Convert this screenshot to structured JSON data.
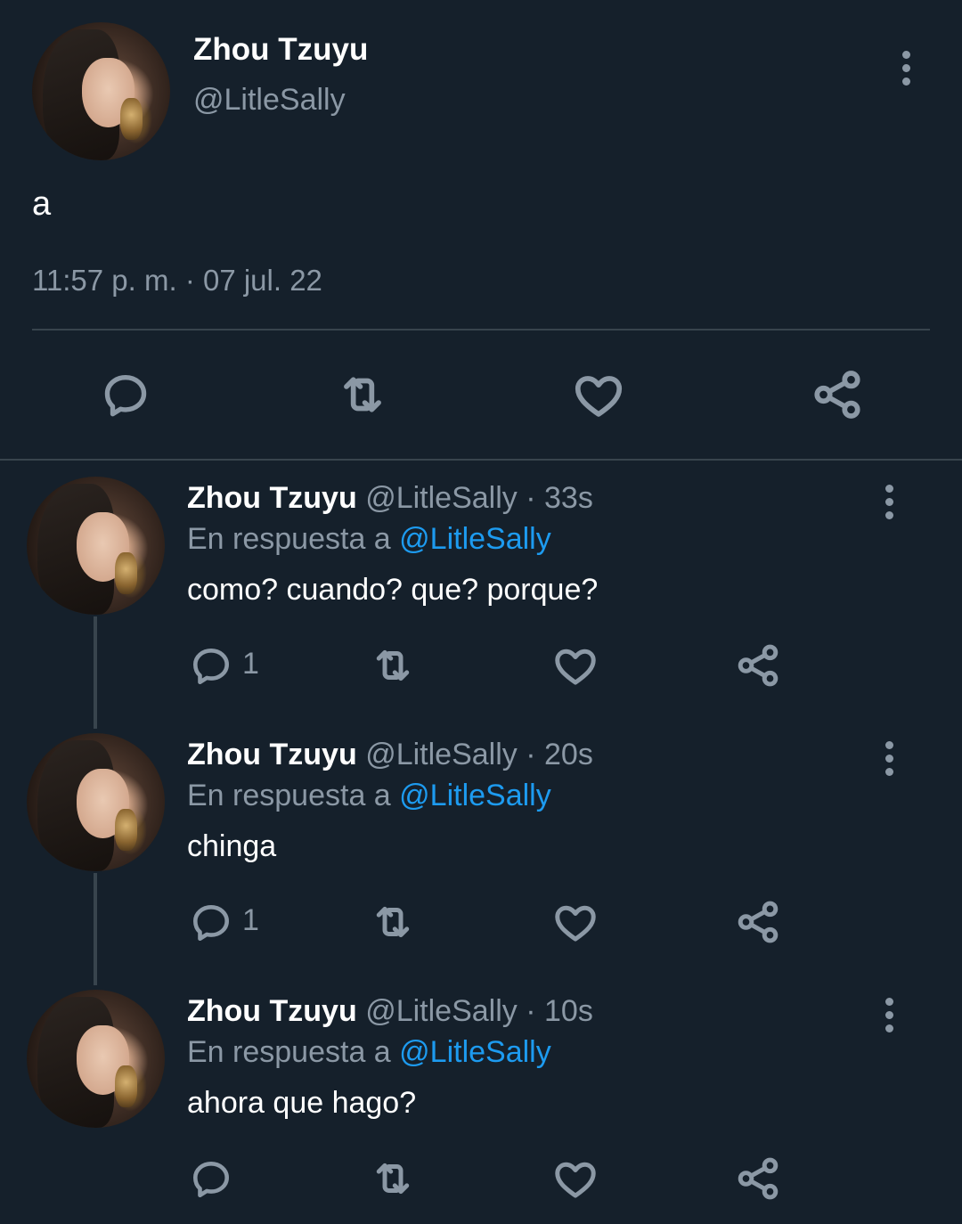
{
  "main_tweet": {
    "display_name": "Zhou Tzuyu",
    "handle": "@LitleSally",
    "text": "a",
    "timestamp": "11:57 p. m. · 07 jul. 22",
    "actions": [
      "reply-icon",
      "retweet-icon",
      "like-icon",
      "share-icon"
    ]
  },
  "replies": [
    {
      "display_name": "Zhou Tzuyu",
      "meta": "@LitleSally · 33s",
      "reply_prefix": "En respuesta a",
      "reply_to": "@LitleSally",
      "text": "como? cuando? que? porque?",
      "reply_count": "1"
    },
    {
      "display_name": "Zhou Tzuyu",
      "meta": "@LitleSally · 20s",
      "reply_prefix": "En respuesta a",
      "reply_to": "@LitleSally",
      "text": "chinga",
      "reply_count": "1"
    },
    {
      "display_name": "Zhou Tzuyu",
      "meta": "@LitleSally · 10s",
      "reply_prefix": "En respuesta a",
      "reply_to": "@LitleSally",
      "text": "ahora que hago?",
      "reply_count": ""
    }
  ],
  "colors": {
    "background": "#15202b",
    "muted": "#8b98a5",
    "link": "#1d9bf0",
    "divider": "#38444d"
  }
}
